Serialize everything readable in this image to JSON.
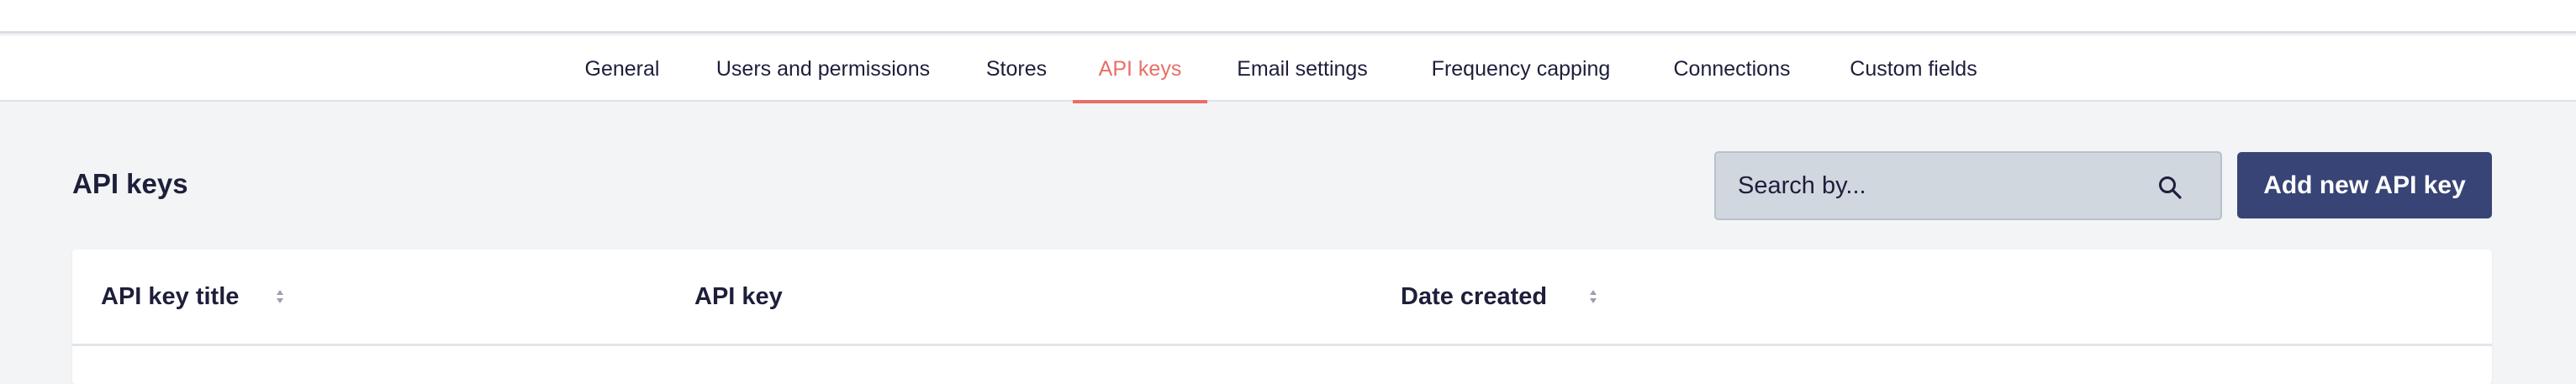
{
  "tabs": [
    {
      "label": "General",
      "active": false
    },
    {
      "label": "Users and permissions",
      "active": false
    },
    {
      "label": "Stores",
      "active": false
    },
    {
      "label": "API keys",
      "active": true
    },
    {
      "label": "Email settings",
      "active": false
    },
    {
      "label": "Frequency capping",
      "active": false
    },
    {
      "label": "Connections",
      "active": false
    },
    {
      "label": "Custom fields",
      "active": false
    }
  ],
  "page": {
    "title": "API keys"
  },
  "search": {
    "placeholder": "Search by...",
    "icon": "search-icon"
  },
  "actions": {
    "add_label": "Add new API key"
  },
  "table": {
    "columns": [
      {
        "label": "API key title",
        "sortable": true
      },
      {
        "label": "API key",
        "sortable": false
      },
      {
        "label": "Date created",
        "sortable": true
      }
    ],
    "rows": []
  },
  "colors": {
    "accent": "#ea6e67",
    "primary_button": "#384476",
    "text": "#1d1f3a",
    "background": "#f3f4f6"
  }
}
